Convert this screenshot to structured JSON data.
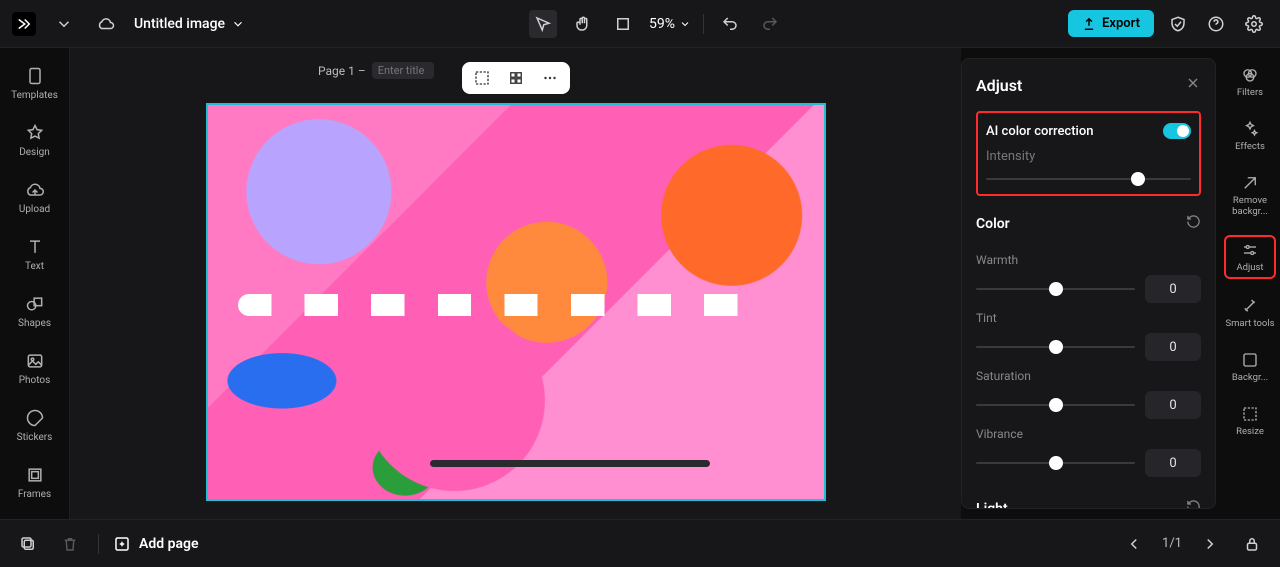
{
  "topbar": {
    "title": "Untitled image",
    "zoom": "59%",
    "export": "Export"
  },
  "left_rail": {
    "items": [
      {
        "label": "Templates"
      },
      {
        "label": "Design"
      },
      {
        "label": "Upload"
      },
      {
        "label": "Text"
      },
      {
        "label": "Shapes"
      },
      {
        "label": "Photos"
      },
      {
        "label": "Stickers"
      },
      {
        "label": "Frames"
      }
    ]
  },
  "canvas": {
    "page_prefix": "Page 1 –",
    "title_placeholder": "Enter title"
  },
  "adjust_panel": {
    "title": "Adjust",
    "ai_label": "AI color correction",
    "intensity_label": "Intensity",
    "intensity_pct": 74,
    "color_section": "Color",
    "params": [
      {
        "label": "Warmth",
        "value": 0
      },
      {
        "label": "Tint",
        "value": 0
      },
      {
        "label": "Saturation",
        "value": 0
      },
      {
        "label": "Vibrance",
        "value": 0
      }
    ],
    "light_section": "Light"
  },
  "right_rail": {
    "items": [
      {
        "label": "Filters"
      },
      {
        "label": "Effects"
      },
      {
        "label": "Remove backgr..."
      },
      {
        "label": "Adjust"
      },
      {
        "label": "Smart tools"
      },
      {
        "label": "Backgr..."
      },
      {
        "label": "Resize"
      }
    ]
  },
  "bottombar": {
    "add_page": "Add page",
    "page_counter": "1/1"
  }
}
